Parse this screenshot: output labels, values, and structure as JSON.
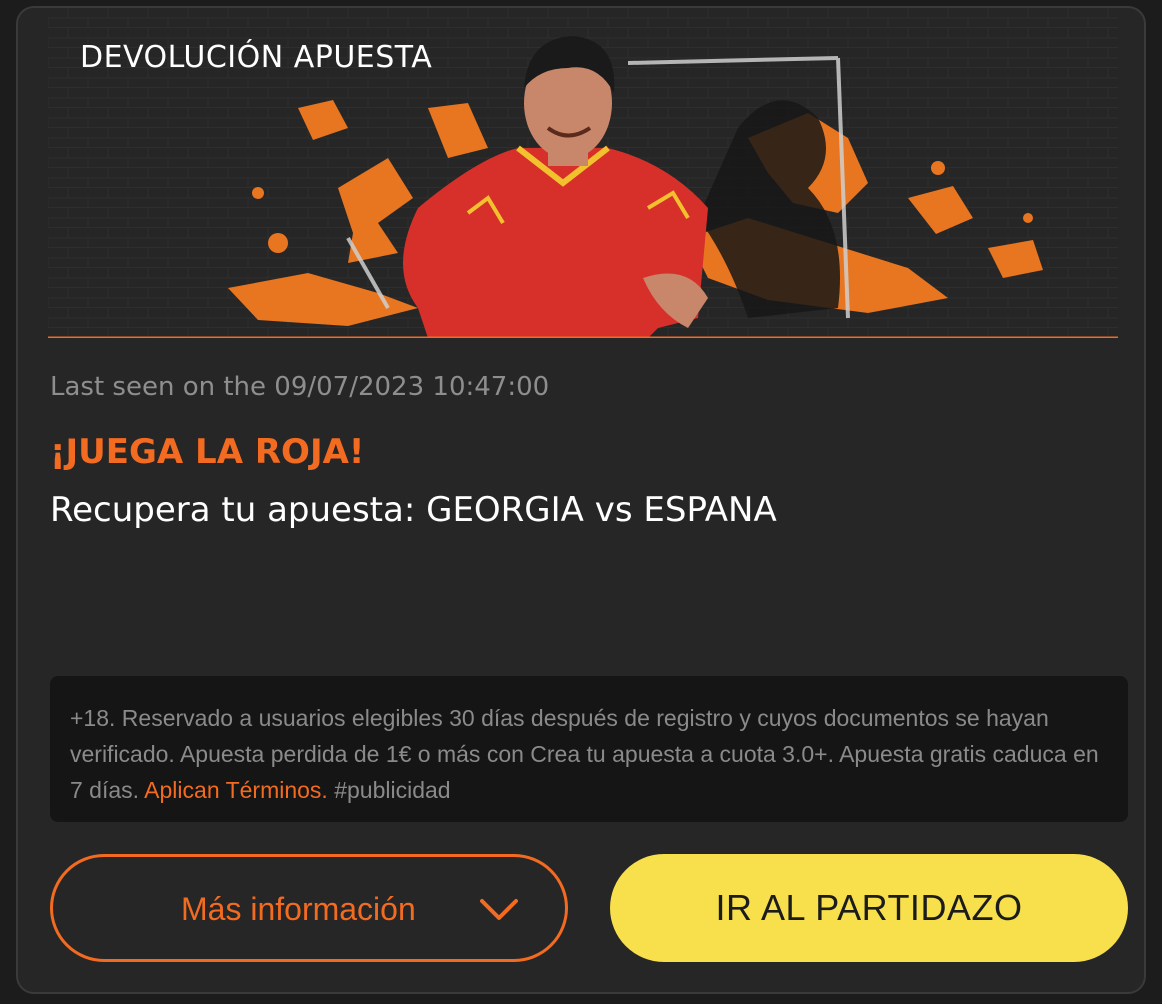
{
  "promo": {
    "type_label": "DEVOLUCIÓN APUESTA",
    "last_seen": "Last seen on the 09/07/2023 10:47:00",
    "headline": "¡JUEGA LA ROJA!",
    "subheadline": "Recupera tu apuesta: GEORGIA vs ESPANA"
  },
  "terms": {
    "text": "+18. Reservado a usuarios elegibles 30 días después de registro y cuyos documentos se hayan verificado. Apuesta perdida de 1€ o más con Crea tu apuesta a cuota 3.0+. Apuesta gratis caduca en 7 días.",
    "link_label": "Aplican Términos.",
    "hashtag": "#publicidad"
  },
  "buttons": {
    "more_info_label": "Más información",
    "cta_label": "IR AL PARTIDAZO"
  },
  "icons": {
    "more_info": "chevron-down-icon"
  },
  "colors": {
    "accent": "#f26b21",
    "cta_background": "#f7e04b",
    "card_background": "#262626",
    "terms_background": "#151515",
    "muted_text": "#8e8e8e"
  }
}
